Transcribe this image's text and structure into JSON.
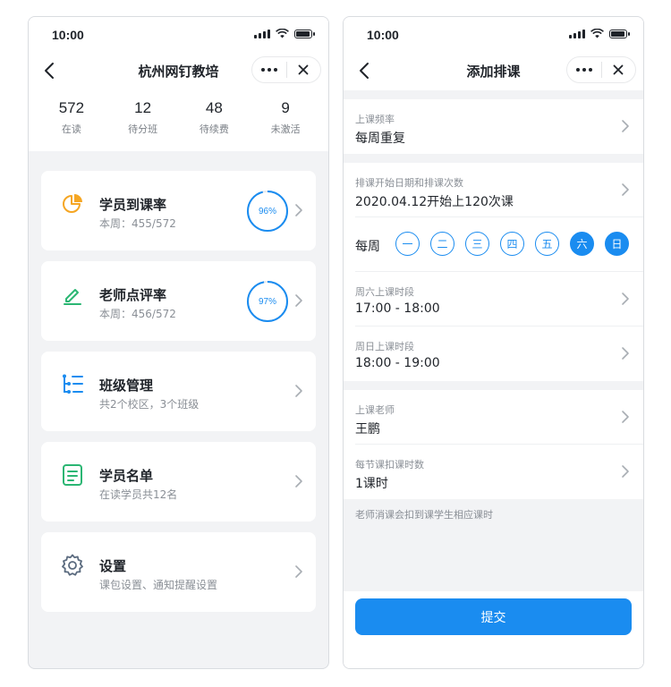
{
  "left": {
    "status_time": "10:00",
    "title": "杭州网钉教培",
    "stats": [
      {
        "value": "572",
        "label": "在读"
      },
      {
        "value": "12",
        "label": "待分班"
      },
      {
        "value": "48",
        "label": "待续费"
      },
      {
        "value": "9",
        "label": "未激活"
      }
    ],
    "cards": [
      {
        "title": "学员到课率",
        "sub": "本周：455/572",
        "progress_label": "96%",
        "progress": 0.96,
        "icon": "pie-chart-icon"
      },
      {
        "title": "老师点评率",
        "sub": "本周：456/572",
        "progress_label": "97%",
        "progress": 0.97,
        "icon": "pen-icon"
      },
      {
        "title": "班级管理",
        "sub": "共2个校区，3个班级",
        "icon": "class-list-icon"
      },
      {
        "title": "学员名单",
        "sub": "在读学员共12名",
        "icon": "roster-icon"
      },
      {
        "title": "设置",
        "sub": "课包设置、通知提醒设置",
        "icon": "gear-icon"
      }
    ],
    "colors": {
      "accent": "#1a8cf0",
      "pie": "#f5a623",
      "pen": "#2bb673",
      "list": "#1a8cf0",
      "roster": "#2bb673",
      "gear": "#5b6b7f"
    }
  },
  "right": {
    "status_time": "10:00",
    "title": "添加排课",
    "frequency": {
      "label": "上课频率",
      "value": "每周重复"
    },
    "start": {
      "label": "排课开始日期和排课次数",
      "value": "2020.04.12开始上120次课"
    },
    "week": {
      "label": "每周",
      "days": [
        {
          "label": "一",
          "selected": false
        },
        {
          "label": "二",
          "selected": false
        },
        {
          "label": "三",
          "selected": false
        },
        {
          "label": "四",
          "selected": false
        },
        {
          "label": "五",
          "selected": false
        },
        {
          "label": "六",
          "selected": true
        },
        {
          "label": "日",
          "selected": true
        }
      ]
    },
    "saturday": {
      "label": "周六上课时段",
      "value": "17:00 - 18:00"
    },
    "sunday": {
      "label": "周日上课时段",
      "value": "18:00 - 19:00"
    },
    "teacher": {
      "label": "上课老师",
      "value": "王鹏"
    },
    "hours": {
      "label": "每节课扣课时数",
      "value": "1课时"
    },
    "hint": "老师消课会扣到课学生相应课时",
    "submit_label": "提交"
  }
}
